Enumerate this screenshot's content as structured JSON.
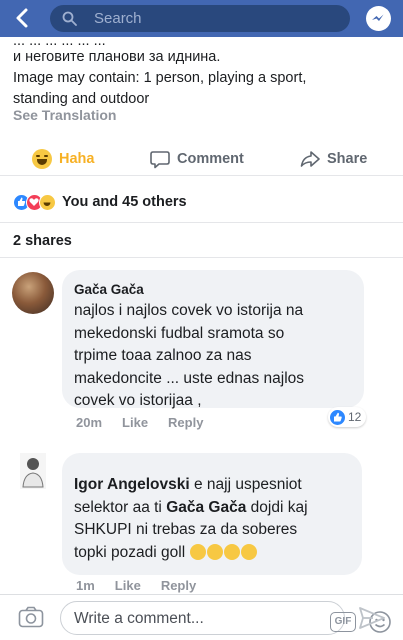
{
  "search": {
    "placeholder": "Search"
  },
  "post": {
    "caption_cut": "... ... ... ... ... ...",
    "caption_line1": "и неговите планови за иднина.",
    "caption_line2": "Image may contain: 1 person, playing a sport,",
    "caption_line3": "standing and outdoor",
    "see_translation": "See Translation"
  },
  "actions": {
    "haha": "Haha",
    "comment": "Comment",
    "share": "Share"
  },
  "reactions": {
    "summary": "You and 45 others"
  },
  "shares": {
    "label": "2 shares"
  },
  "comments": [
    {
      "author": "Gača Gača",
      "lines": [
        "najlos i najlos covek vo istorija na",
        "mekedonski fudbal sramota so",
        "trpime toaa zalnoo za nas",
        "makedoncite ... uste ednas najlos",
        "covek vo istorijaa ,"
      ],
      "time": "20m",
      "like": "Like",
      "reply": "Reply",
      "likes_count": "12"
    },
    {
      "mention1": "Igor Angelovski",
      "text1": " e najj uspesniot",
      "line2": "selektor aa ti ",
      "mention2": "Gača Gača",
      "text2": " dojdi kaj",
      "line3": "SHKUPI ni trebas za da soberes",
      "line4": "topki pozadi goll",
      "time": "1m",
      "like": "Like",
      "reply": "Reply"
    }
  ],
  "composer": {
    "placeholder": "Write a comment...",
    "gif": "GIF"
  },
  "colors": {
    "brand": "#4267b2",
    "haha": "#f7b125",
    "like": "#2d88ff",
    "love": "#f33e58"
  }
}
